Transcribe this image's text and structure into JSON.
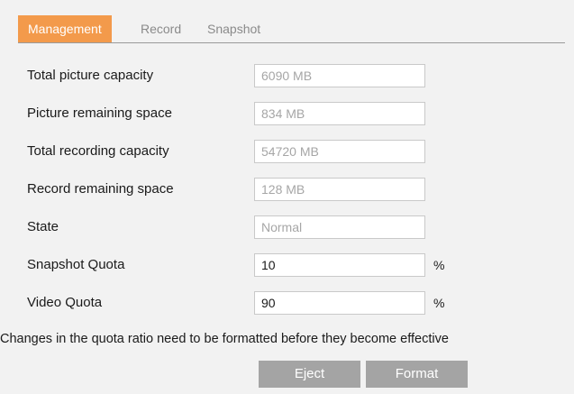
{
  "tabs": [
    {
      "label": "Management",
      "active": true
    },
    {
      "label": "Record",
      "active": false
    },
    {
      "label": "Snapshot",
      "active": false
    }
  ],
  "fields": {
    "total_picture_capacity": {
      "label": "Total picture capacity",
      "value": "6090 MB"
    },
    "picture_remaining_space": {
      "label": "Picture remaining space",
      "value": "834 MB"
    },
    "total_recording_capacity": {
      "label": "Total recording capacity",
      "value": "54720 MB"
    },
    "record_remaining_space": {
      "label": "Record remaining space",
      "value": "128 MB"
    },
    "state": {
      "label": "State",
      "value": "Normal"
    },
    "snapshot_quota": {
      "label": "Snapshot Quota",
      "value": "10",
      "unit": "%"
    },
    "video_quota": {
      "label": "Video Quota",
      "value": "90",
      "unit": "%"
    }
  },
  "note": "Changes in the quota ratio need to be formatted before they become effective",
  "buttons": {
    "eject": "Eject",
    "format": "Format"
  },
  "colors": {
    "active_tab": "#f39a4b",
    "button": "#a4a4a4",
    "background": "#f2f2f2"
  }
}
